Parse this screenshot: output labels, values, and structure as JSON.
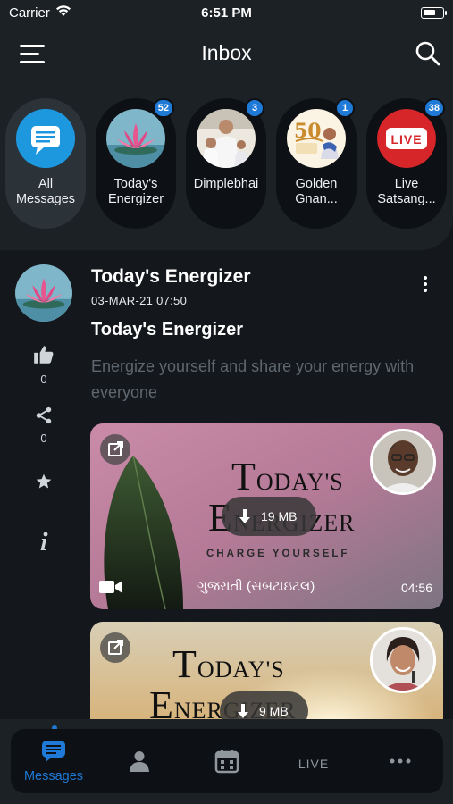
{
  "status_bar": {
    "carrier": "Carrier",
    "time": "6:51 PM"
  },
  "header": {
    "title": "Inbox"
  },
  "channels": [
    {
      "label": "All Messages",
      "icon": "chat-bubble-icon",
      "badge": "",
      "active": true
    },
    {
      "label": "Today's Energizer",
      "icon": "lotus-avatar",
      "badge": "52"
    },
    {
      "label": "Dimplebhai",
      "icon": "dimplebhai-avatar",
      "badge": "3"
    },
    {
      "label": "Golden Gnan...",
      "icon": "golden-gnan-avatar",
      "badge": "1"
    },
    {
      "label": "Live Satsang...",
      "icon": "live-avatar",
      "badge": "38",
      "avatar_text": "LIVE"
    }
  ],
  "post": {
    "channel_name": "Today's Energizer",
    "date": "03-MAR-21  07:50",
    "title": "Today's Energizer",
    "description": "Energize yourself and share your energy with everyone",
    "likes": "0",
    "shares": "0",
    "media": [
      {
        "title_line1_big": "T",
        "title_line1_small": "ODAY'S",
        "title_line2_big": "E",
        "title_line2_small": "NERGIZER",
        "tagline": "CHARGE YOURSELF",
        "size": "19 MB",
        "language": "ગુજરાતી (સબટાઇટલ)",
        "duration": "04:56",
        "type": "video"
      },
      {
        "title_line1_big": "T",
        "title_line1_small": "ODAY'S",
        "title_line2_big": "E",
        "title_line2_small": "NERGIZER",
        "size": "9 MB"
      }
    ]
  },
  "tabs": [
    {
      "label": "Messages",
      "icon": "messages-icon",
      "active": true
    },
    {
      "label": "",
      "icon": "profile-icon"
    },
    {
      "label": "",
      "icon": "calendar-icon"
    },
    {
      "label": "LIVE",
      "icon": "live-text-icon"
    },
    {
      "label": "",
      "icon": "more-horizontal-icon"
    }
  ],
  "colors": {
    "accent": "#1f79d6",
    "background": "#14181d",
    "header": "#1c2126",
    "muted_text": "#5f666d"
  }
}
